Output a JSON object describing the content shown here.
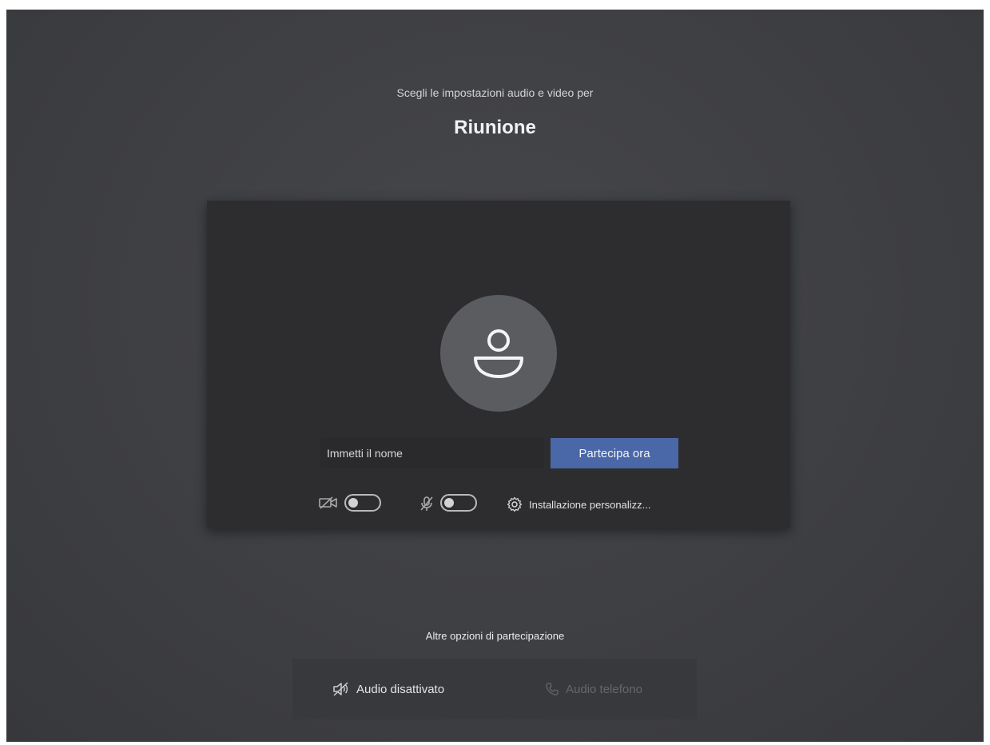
{
  "header": {
    "subtitle": "Scegli le impostazioni audio e video per",
    "title": "Riunione"
  },
  "preview": {
    "avatar_icon": "person-icon",
    "name_input": {
      "value": "",
      "placeholder": "Immetti il nome"
    },
    "join_button_label": "Partecipa ora",
    "controls": {
      "camera_icon": "camera-off-icon",
      "camera_on": false,
      "mic_icon": "mic-off-icon",
      "mic_on": false,
      "settings_icon": "gear-icon",
      "settings_label": "Installazione personalizz..."
    }
  },
  "other_options": {
    "title": "Altre opzioni di partecipazione",
    "items": [
      {
        "label": "Audio disattivato",
        "icon": "speaker-off-icon",
        "state": "active"
      },
      {
        "label": "Audio telefono",
        "icon": "phone-icon",
        "state": "disabled"
      }
    ]
  },
  "colors": {
    "background": "#3f4044",
    "preview_panel": "#2d2d30",
    "accent_button": "#4a67a8",
    "avatar_circle": "#5b5c60"
  }
}
